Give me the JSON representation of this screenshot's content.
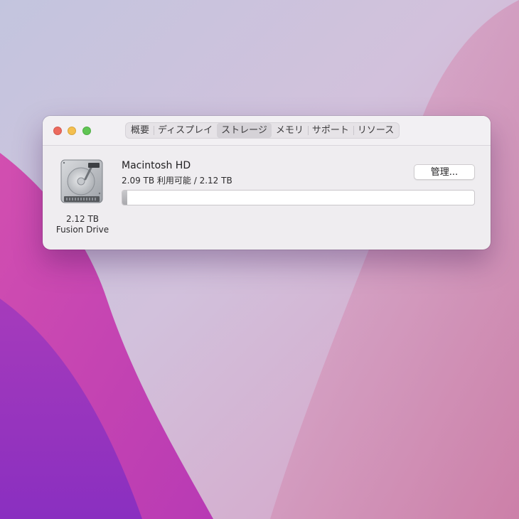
{
  "window": {
    "tabs": [
      {
        "label": "概要"
      },
      {
        "label": "ディスプレイ"
      },
      {
        "label": "ストレージ"
      },
      {
        "label": "メモリ"
      },
      {
        "label": "サポート"
      },
      {
        "label": "リソース"
      }
    ],
    "selected_tab": "ストレージ"
  },
  "disk": {
    "icon": "hard-drive-icon",
    "capacity": "2.12 TB",
    "kind": "Fusion Drive"
  },
  "volume": {
    "name": "Macintosh HD",
    "usage_text": "2.09 TB 利用可能 / 2.12 TB",
    "used_fraction": 0.014,
    "manage_label": "管理..."
  },
  "colors": {
    "close": "#ec6a5e",
    "minimize": "#f4bf4f",
    "zoom": "#61c554"
  }
}
